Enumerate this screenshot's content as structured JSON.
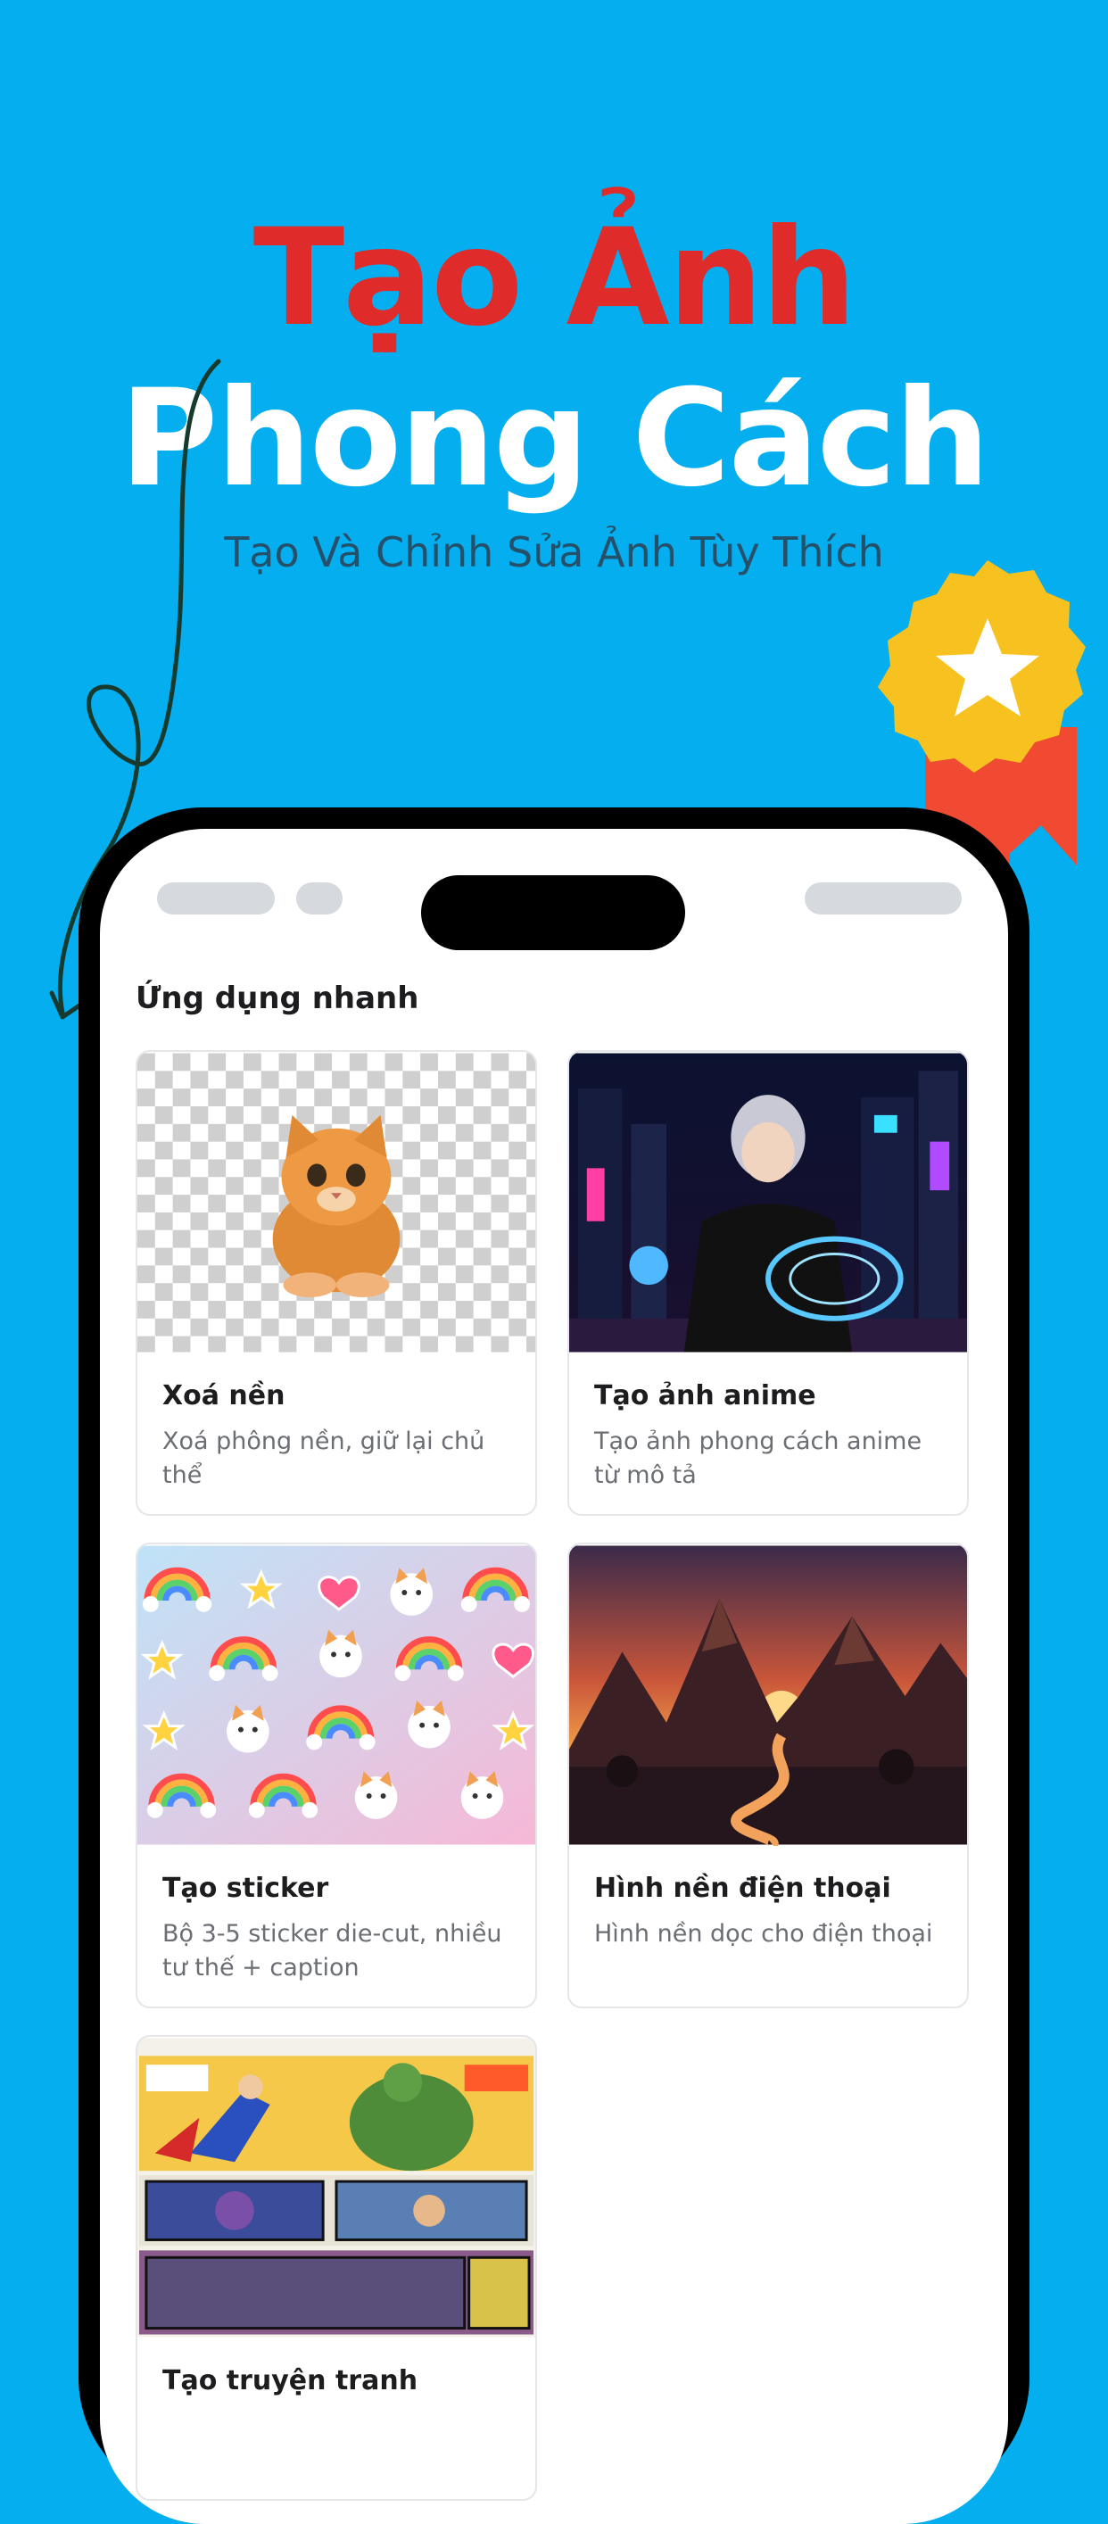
{
  "hero": {
    "title_line1": "Tạo Ảnh",
    "title_line2": "Phong Cách",
    "subtitle": "Tạo Và Chỉnh Sửa Ảnh Tùy Thích"
  },
  "colors": {
    "background": "#04AEEF",
    "title_accent": "#E02B2B",
    "badge_gold": "#F7C21F",
    "ribbon": "#F04A32"
  },
  "icons": [
    "squiggle-arrow-icon",
    "star-badge-icon",
    "cat-icon",
    "rainbow-icon",
    "heart-icon",
    "star-icon"
  ],
  "app": {
    "section_title": "Ứng dụng nhanh",
    "cards": [
      {
        "title": "Xoá nền",
        "desc": "Xoá phông nền, giữ lại chủ thể",
        "image": "cat-transparent-bg"
      },
      {
        "title": "Tạo ảnh anime",
        "desc": "Tạo ảnh phong cách anime từ mô tả",
        "image": "anime-neon-city"
      },
      {
        "title": "Tạo sticker",
        "desc": "Bộ 3-5 sticker die-cut, nhiều tư thế + caption",
        "image": "sticker-sheet"
      },
      {
        "title": "Hình nền điện thoại",
        "desc": "Hình nền dọc cho điện thoại",
        "image": "mountain-sunset"
      },
      {
        "title": "Tạo truyện tranh",
        "desc": "",
        "image": "comic-panels"
      }
    ]
  }
}
